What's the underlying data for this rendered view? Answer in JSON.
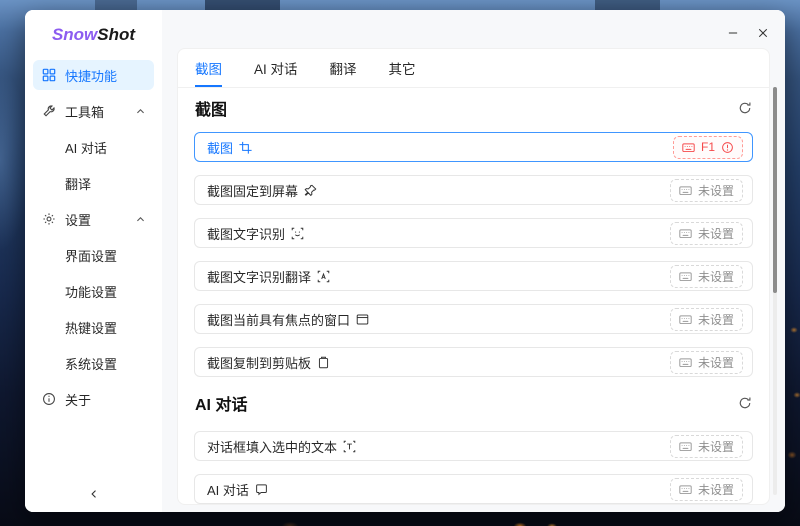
{
  "colors": {
    "accent": "#1677ff",
    "selected_bg": "#e6f4ff",
    "error": "#ff4d4f",
    "logo_purple": "#8c5cf0",
    "active_border": "#4096ff"
  },
  "window": {
    "app": "SnowShot"
  },
  "sidebar": {
    "logo": {
      "part1": "Snow",
      "part2": "Shot"
    },
    "items": [
      {
        "label": "快捷功能",
        "icon": "appstore-icon",
        "selected": true
      },
      {
        "label": "工具箱",
        "icon": "tool-icon",
        "expanded": true
      },
      {
        "label": "AI 对话"
      },
      {
        "label": "翻译"
      },
      {
        "label": "设置",
        "icon": "gear-icon",
        "expanded": true
      },
      {
        "label": "界面设置"
      },
      {
        "label": "功能设置"
      },
      {
        "label": "热键设置"
      },
      {
        "label": "系统设置"
      },
      {
        "label": "关于",
        "icon": "info-icon"
      }
    ]
  },
  "tabs": [
    {
      "label": "截图",
      "active": true
    },
    {
      "label": "AI 对话"
    },
    {
      "label": "翻译"
    },
    {
      "label": "其它"
    }
  ],
  "sections": [
    {
      "title": "截图",
      "rows": [
        {
          "label": "截图",
          "icon": "crop-icon",
          "hotkey": "F1",
          "status": "error",
          "active": true
        },
        {
          "label": "截图固定到屏幕",
          "icon": "pin-icon",
          "hotkey": "未设置",
          "status": "unset"
        },
        {
          "label": "截图文字识别",
          "icon": "ocr-icon",
          "hotkey": "未设置",
          "status": "unset"
        },
        {
          "label": "截图文字识别翻译",
          "icon": "ocr-translate-icon",
          "hotkey": "未设置",
          "status": "unset"
        },
        {
          "label": "截图当前具有焦点的窗口",
          "icon": "focus-window-icon",
          "hotkey": "未设置",
          "status": "unset"
        },
        {
          "label": "截图复制到剪贴板",
          "icon": "clipboard-icon",
          "hotkey": "未设置",
          "status": "unset"
        }
      ]
    },
    {
      "title": "AI 对话",
      "rows": [
        {
          "label": "对话框填入选中的文本",
          "icon": "text-select-icon",
          "hotkey": "未设置",
          "status": "unset"
        },
        {
          "label": "AI 对话",
          "icon": "chat-icon",
          "hotkey": "未设置",
          "status": "unset"
        }
      ]
    }
  ]
}
